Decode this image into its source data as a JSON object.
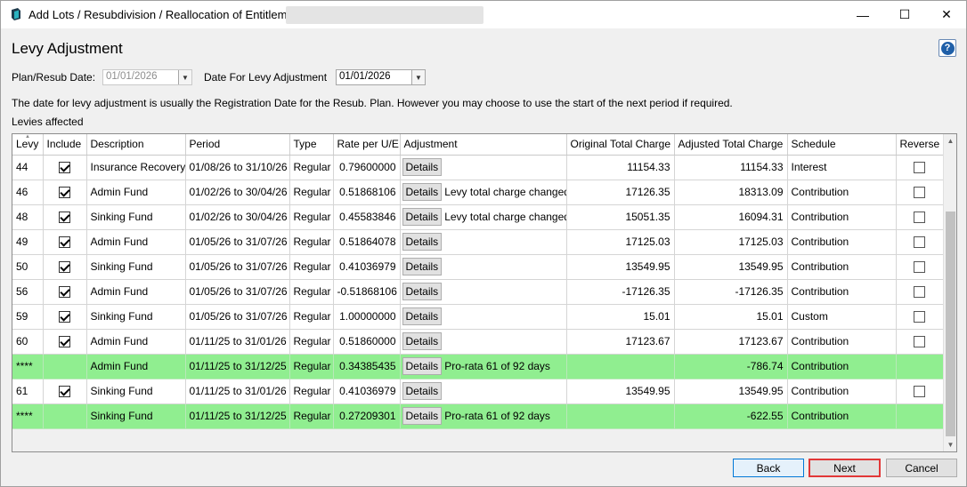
{
  "window": {
    "title": "Add Lots / Resubdivision / Reallocation of Entitlements",
    "minimize_glyph": "—",
    "maximize_glyph": "☐",
    "close_glyph": "✕"
  },
  "page": {
    "heading": "Levy Adjustment",
    "help_glyph": "?"
  },
  "form": {
    "plan_date_label": "Plan/Resub Date:",
    "plan_date_value": "01/01/2026",
    "levy_date_label": "Date For Levy Adjustment",
    "levy_date_value": "01/01/2026",
    "info_text": "The date for levy adjustment is usually the Registration Date for the Resub. Plan. However you may choose to use the start of the next period if required.",
    "levies_label": "Levies affected"
  },
  "table": {
    "columns": [
      "Levy",
      "Include",
      "Description",
      "Period",
      "Type",
      "Rate per U/E",
      "Adjustment",
      "Original Total Charge",
      "Adjusted Total Charge",
      "Schedule",
      "Reverse"
    ],
    "details_label": "Details",
    "rows": [
      {
        "levy": "44",
        "include": true,
        "description": "Insurance Recovery",
        "period": "01/08/26 to 31/10/26",
        "type": "Regular",
        "rate": "0.79600000",
        "adjustment": "",
        "original": "11154.33",
        "adjusted": "11154.33",
        "schedule": "Interest",
        "reverse": true,
        "highlight": false
      },
      {
        "levy": "46",
        "include": true,
        "description": "Admin Fund",
        "period": "01/02/26 to 30/04/26",
        "type": "Regular",
        "rate": "0.51868106",
        "adjustment": "Levy total charge changed",
        "original": "17126.35",
        "adjusted": "18313.09",
        "schedule": "Contribution",
        "reverse": true,
        "highlight": false
      },
      {
        "levy": "48",
        "include": true,
        "description": "Sinking Fund",
        "period": "01/02/26 to 30/04/26",
        "type": "Regular",
        "rate": "0.45583846",
        "adjustment": "Levy total charge changed",
        "original": "15051.35",
        "adjusted": "16094.31",
        "schedule": "Contribution",
        "reverse": true,
        "highlight": false
      },
      {
        "levy": "49",
        "include": true,
        "description": "Admin Fund",
        "period": "01/05/26 to 31/07/26",
        "type": "Regular",
        "rate": "0.51864078",
        "adjustment": "",
        "original": "17125.03",
        "adjusted": "17125.03",
        "schedule": "Contribution",
        "reverse": true,
        "highlight": false
      },
      {
        "levy": "50",
        "include": true,
        "description": "Sinking Fund",
        "period": "01/05/26 to 31/07/26",
        "type": "Regular",
        "rate": "0.41036979",
        "adjustment": "",
        "original": "13549.95",
        "adjusted": "13549.95",
        "schedule": "Contribution",
        "reverse": true,
        "highlight": false
      },
      {
        "levy": "56",
        "include": true,
        "description": "Admin Fund",
        "period": "01/05/26 to 31/07/26",
        "type": "Regular",
        "rate": "-0.51868106",
        "adjustment": "",
        "original": "-17126.35",
        "adjusted": "-17126.35",
        "schedule": "Contribution",
        "reverse": true,
        "highlight": false
      },
      {
        "levy": "59",
        "include": true,
        "description": "Sinking Fund",
        "period": "01/05/26 to 31/07/26",
        "type": "Regular",
        "rate": "1.00000000",
        "adjustment": "",
        "original": "15.01",
        "adjusted": "15.01",
        "schedule": "Custom",
        "reverse": true,
        "highlight": false
      },
      {
        "levy": "60",
        "include": true,
        "description": "Admin Fund",
        "period": "01/11/25 to 31/01/26",
        "type": "Regular",
        "rate": "0.51860000",
        "adjustment": "",
        "original": "17123.67",
        "adjusted": "17123.67",
        "schedule": "Contribution",
        "reverse": true,
        "highlight": false
      },
      {
        "levy": "****",
        "include": false,
        "description": "Admin Fund",
        "period": "01/11/25 to 31/12/25",
        "type": "Regular",
        "rate": "0.34385435",
        "adjustment": "Pro-rata 61 of 92 days",
        "original": "",
        "adjusted": "-786.74",
        "schedule": "Contribution",
        "reverse": false,
        "highlight": true
      },
      {
        "levy": "61",
        "include": true,
        "description": "Sinking Fund",
        "period": "01/11/25 to 31/01/26",
        "type": "Regular",
        "rate": "0.41036979",
        "adjustment": "",
        "original": "13549.95",
        "adjusted": "13549.95",
        "schedule": "Contribution",
        "reverse": true,
        "highlight": false
      },
      {
        "levy": "****",
        "include": false,
        "description": "Sinking Fund",
        "period": "01/11/25 to 31/12/25",
        "type": "Regular",
        "rate": "0.27209301",
        "adjustment": "Pro-rata 61 of 92 days",
        "original": "",
        "adjusted": "-622.55",
        "schedule": "Contribution",
        "reverse": false,
        "highlight": true
      }
    ]
  },
  "footer": {
    "back_label": "Back",
    "next_label": "Next",
    "cancel_label": "Cancel"
  },
  "colors": {
    "highlight_row": "#90ee90",
    "next_border": "#e23838",
    "back_border": "#0078d7"
  }
}
